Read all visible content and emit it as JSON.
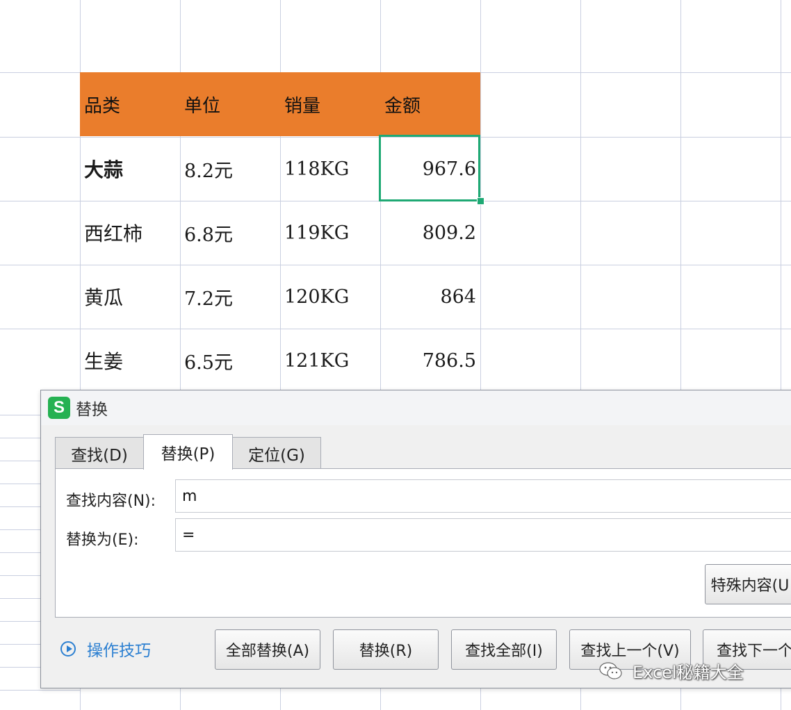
{
  "sheet": {
    "headers": [
      "品类",
      "单位",
      "销量",
      "金额"
    ],
    "rows": [
      {
        "category": "大蒜",
        "unit": "8.2元",
        "sales": "118KG",
        "amount": "967.6"
      },
      {
        "category": "西红柿",
        "unit": "6.8元",
        "sales": "119KG",
        "amount": "809.2"
      },
      {
        "category": "黄瓜",
        "unit": "7.2元",
        "sales": "120KG",
        "amount": "864"
      },
      {
        "category": "生姜",
        "unit": "6.5元",
        "sales": "121KG",
        "amount": "786.5"
      }
    ],
    "header_color": "#ea7d2c",
    "selection_color": "#1fa974"
  },
  "dialog": {
    "app_icon_letter": "S",
    "title": "替换",
    "tabs": [
      {
        "label": "查找(D)"
      },
      {
        "label": "替换(P)"
      },
      {
        "label": "定位(G)"
      }
    ],
    "active_tab": "替换(P)",
    "find_label": "查找内容(N):",
    "find_value": "m",
    "replace_label": "替换为(E):",
    "replace_value": "=",
    "special_button": "特殊内容(U",
    "tips_label": "操作技巧",
    "buttons": {
      "replace_all": "全部替换(A)",
      "replace": "替换(R)",
      "find_all": "查找全部(I)",
      "find_prev": "查找上一个(V)",
      "find_next": "查找下一个"
    }
  },
  "watermark": "Excel秘籍大全"
}
